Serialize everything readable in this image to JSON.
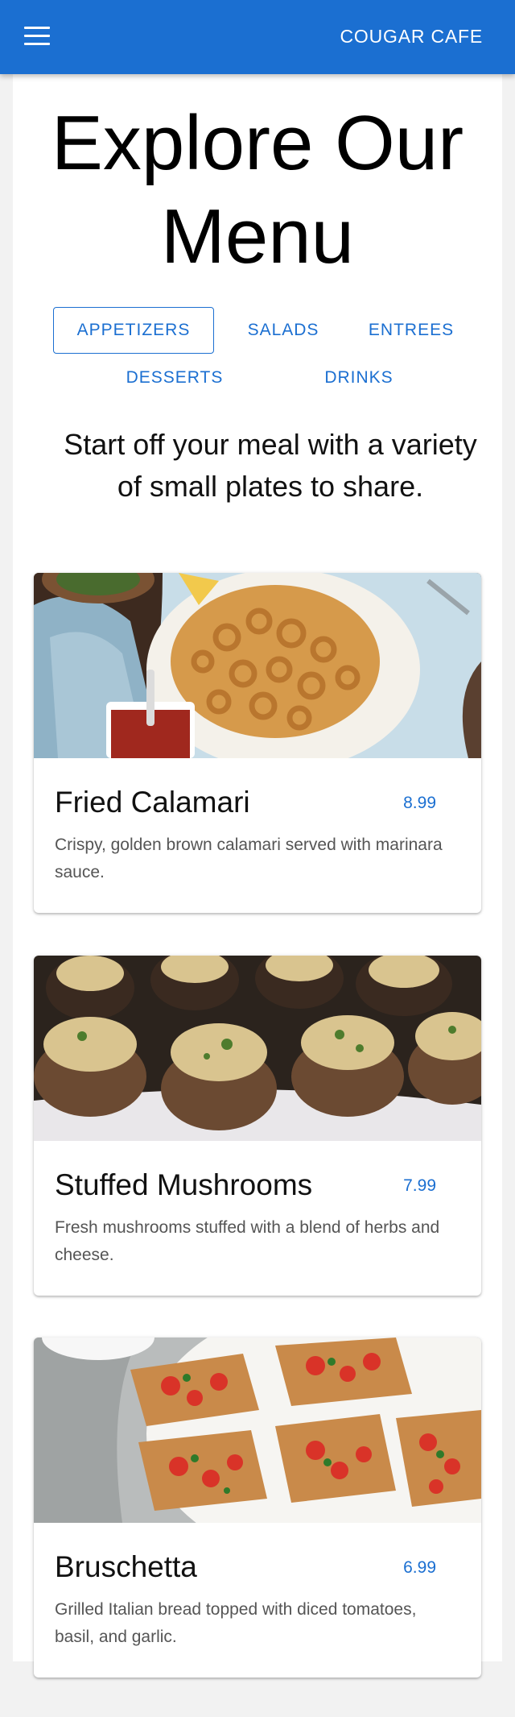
{
  "appbar": {
    "brand": "COUGAR CAFE",
    "menu_icon": "hamburger-menu-icon"
  },
  "page": {
    "title_line1": "Explore Our",
    "title_line2": "Menu"
  },
  "tabs": [
    {
      "label": "APPETIZERS",
      "active": true
    },
    {
      "label": "SALADS",
      "active": false
    },
    {
      "label": "ENTREES",
      "active": false
    },
    {
      "label": "DESSERTS",
      "active": false
    },
    {
      "label": "DRINKS",
      "active": false
    }
  ],
  "tagline": "Start off your meal with a variety of small plates to share.",
  "items": [
    {
      "name": "Fried Calamari",
      "price": "8.99",
      "description": "Crispy, golden brown calamari served with marinara sauce."
    },
    {
      "name": "Stuffed Mushrooms",
      "price": "7.99",
      "description": "Fresh mushrooms stuffed with a blend of herbs and cheese."
    },
    {
      "name": "Bruschetta",
      "price": "6.99",
      "description": "Grilled Italian bread topped with diced tomatoes, basil, and garlic."
    }
  ],
  "colors": {
    "primary": "#1b6fd1",
    "background": "#f2f2f2",
    "card": "#ffffff",
    "text": "#111111",
    "muted": "#555555"
  }
}
